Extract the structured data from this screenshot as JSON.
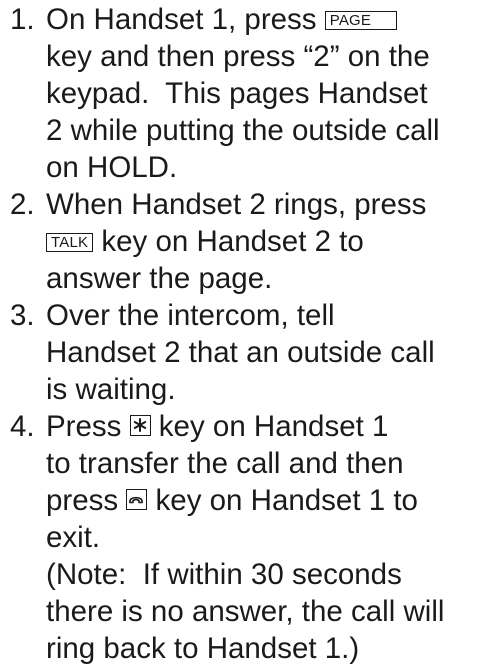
{
  "steps": [
    {
      "number": "1.",
      "text_before_key": "On Handset 1, press ",
      "key": "PAGE",
      "text_after_key": " key and then press “2” on the keypad.  This pages Handset 2 while putting the outside call on HOLD."
    },
    {
      "number": "2.",
      "text_before_key": "When Handset 2 rings, press ",
      "key": "TALK",
      "text_after_key": " key on Handset 2 to answer the page."
    },
    {
      "number": "3.",
      "text": "Over the intercom, tell Handset 2 that an outside call is waiting."
    },
    {
      "number": "4.",
      "text_1": "Press ",
      "key_1_icon": "star-key-icon",
      "text_2": " key on Handset 1 to transfer the call and then press ",
      "key_2_icon": "end-call-key-icon",
      "text_3": " key on Handset 1 to exit.",
      "note": "(Note:  If within 30 seconds there is no answer, the call will ring back to Handset 1.)"
    }
  ]
}
